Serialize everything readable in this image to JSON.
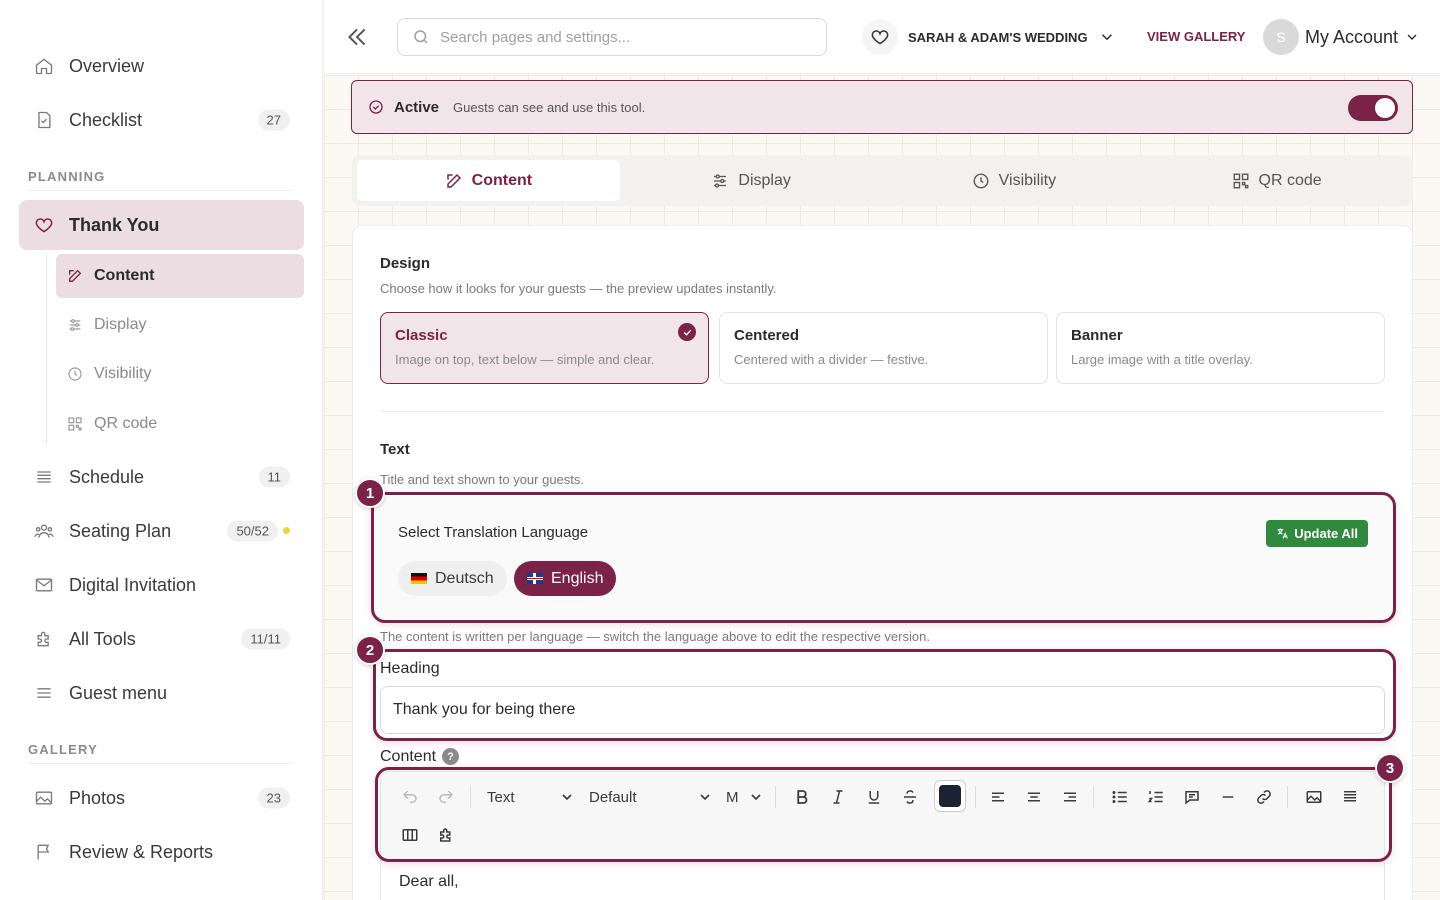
{
  "sidebar": {
    "overview": "Overview",
    "checklist": {
      "label": "Checklist",
      "count": "27"
    },
    "planning_label": "PLANNING",
    "thank_you": "Thank You",
    "sub": {
      "content": "Content",
      "display": "Display",
      "visibility": "Visibility",
      "qr": "QR code"
    },
    "schedule": {
      "label": "Schedule",
      "count": "11"
    },
    "seating": {
      "label": "Seating Plan",
      "count": "50/52"
    },
    "invitation": "Digital Invitation",
    "tools": {
      "label": "All Tools",
      "count": "11/11"
    },
    "guest_menu": "Guest menu",
    "gallery_label": "GALLERY",
    "photos": {
      "label": "Photos",
      "count": "23"
    },
    "review": "Review & Reports"
  },
  "topbar": {
    "search_placeholder": "Search pages and settings...",
    "event": "SARAH & ADAM'S WEDDING",
    "view_gallery": "VIEW GALLERY",
    "avatar_initial": "S",
    "account": "My Account"
  },
  "status": {
    "title": "Active",
    "desc": "Guests can see and use this tool.",
    "enabled": true
  },
  "tabs": {
    "content": "Content",
    "display": "Display",
    "visibility": "Visibility",
    "qr": "QR code"
  },
  "design": {
    "title": "Design",
    "subtitle": "Choose how it looks for your guests — the preview updates instantly.",
    "options": [
      {
        "name": "Classic",
        "desc": "Image on top, text below — simple and clear."
      },
      {
        "name": "Centered",
        "desc": "Centered with a divider — festive."
      },
      {
        "name": "Banner",
        "desc": "Large image with a title overlay."
      }
    ]
  },
  "text_section": {
    "title": "Text",
    "subtitle": "Title and text shown to your guests."
  },
  "translation": {
    "title": "Select Translation Language",
    "update_all": "Update All",
    "langs": [
      "Deutsch",
      "English"
    ]
  },
  "per_language_note": "The content is written per language — switch the language above to edit the respective version.",
  "heading": {
    "label": "Heading",
    "value": "Thank you for being there"
  },
  "content": {
    "label": "Content",
    "help": "?",
    "body": "Dear all,"
  },
  "toolbar": {
    "block_type": "Text",
    "font": "Default",
    "size": "M"
  },
  "callouts": [
    "1",
    "2",
    "3"
  ],
  "colors": {
    "accent": "#7a2346",
    "success": "#2f8a3e",
    "text_color_swatch": "#1a2233"
  }
}
